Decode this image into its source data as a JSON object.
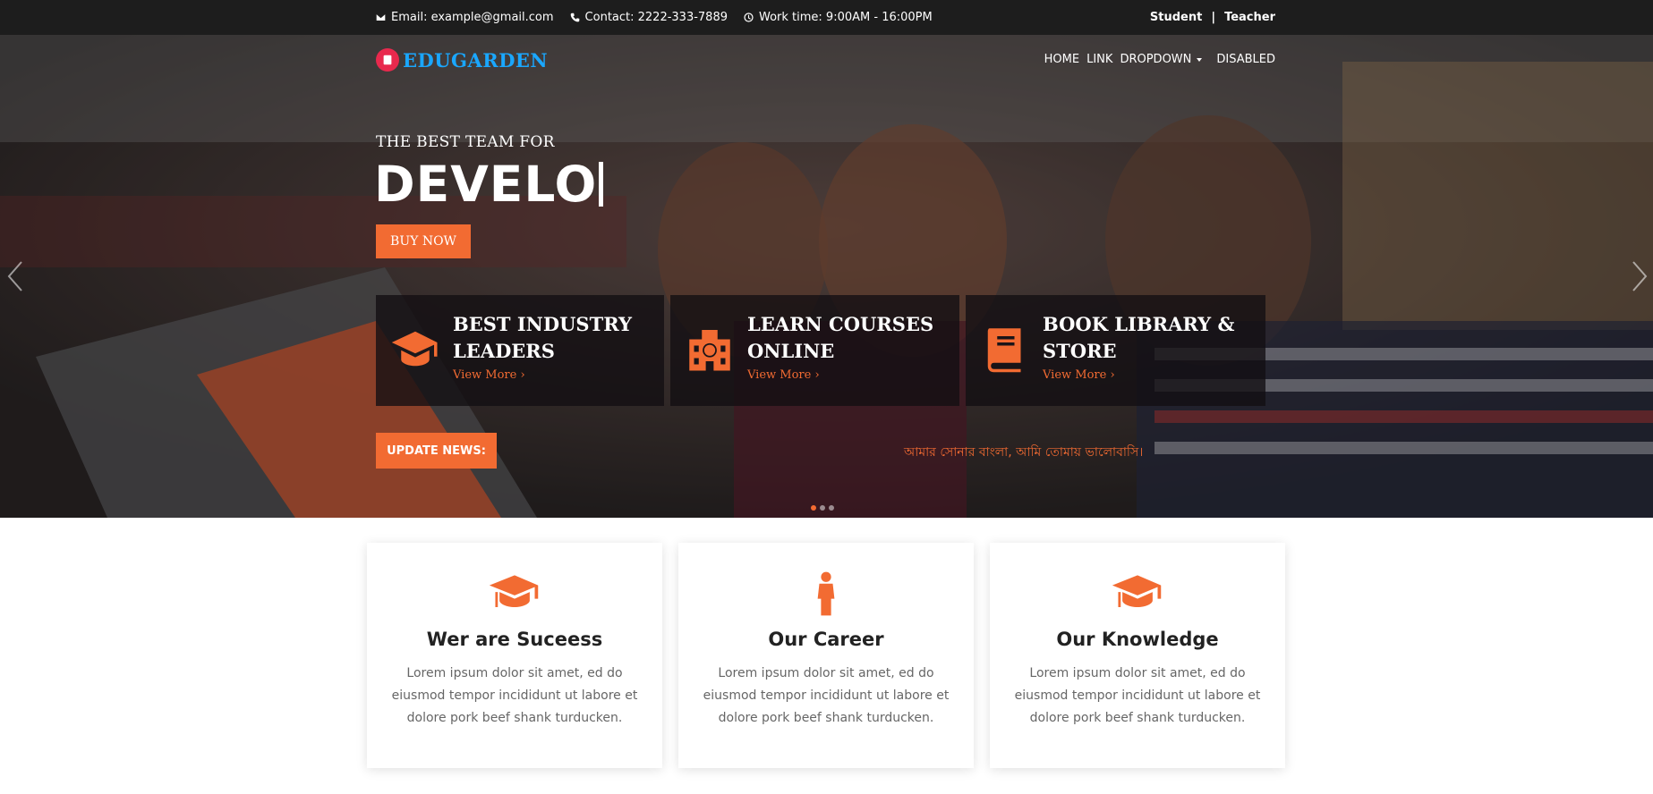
{
  "topbar": {
    "email": "Email: example@gmail.com",
    "contact": "Contact: 2222-333-7889",
    "worktime": "Work time: 9:00AM - 16:00PM",
    "student": "Student",
    "separator": "|",
    "teacher": "Teacher"
  },
  "brand": {
    "name": "EDUGARDEN"
  },
  "nav": {
    "items": [
      "HOME",
      "LINK",
      "DROPDOWN",
      "DISABLED"
    ]
  },
  "hero": {
    "tagline": "THE BEST TEAM FOR",
    "headline": "DEVELO",
    "buy_label": "BUY NOW",
    "features": [
      {
        "title_line1": "BEST INDUSTRY",
        "title_line2": "LEADERS",
        "more": "View More ›",
        "icon": "graduation-cap-icon"
      },
      {
        "title_line1": "LEARN COURSES",
        "title_line2": "ONLINE",
        "more": "View More ›",
        "icon": "school-building-icon"
      },
      {
        "title_line1": "BOOK LIBRARY &",
        "title_line2": "STORE",
        "more": "View More ›",
        "icon": "book-icon"
      }
    ],
    "update_label": "UPDATE NEWS:",
    "ticker": "আমার সোনার বাংলা, আমি তোমায় ভালোবাসি।",
    "slides": 3,
    "active_slide": 1
  },
  "cards": [
    {
      "title": "Wer are Suceess",
      "text": "Lorem ipsum dolor sit amet, ed do eiusmod tempor incididunt ut labore et dolore pork beef shank turducken.",
      "icon": "graduation-cap-icon"
    },
    {
      "title": "Our Career",
      "text": "Lorem ipsum dolor sit amet, ed do eiusmod tempor incididunt ut labore et dolore pork beef shank turducken.",
      "icon": "person-icon"
    },
    {
      "title": "Our Knowledge",
      "text": "Lorem ipsum dolor sit amet, ed do eiusmod tempor incididunt ut labore et dolore pork beef shank turducken.",
      "icon": "graduation-cap-icon"
    }
  ],
  "colors": {
    "accent": "#f26b32",
    "topbar": "#1d1d1d",
    "brand": "#1aa7ff",
    "logo": "#e8294d"
  }
}
